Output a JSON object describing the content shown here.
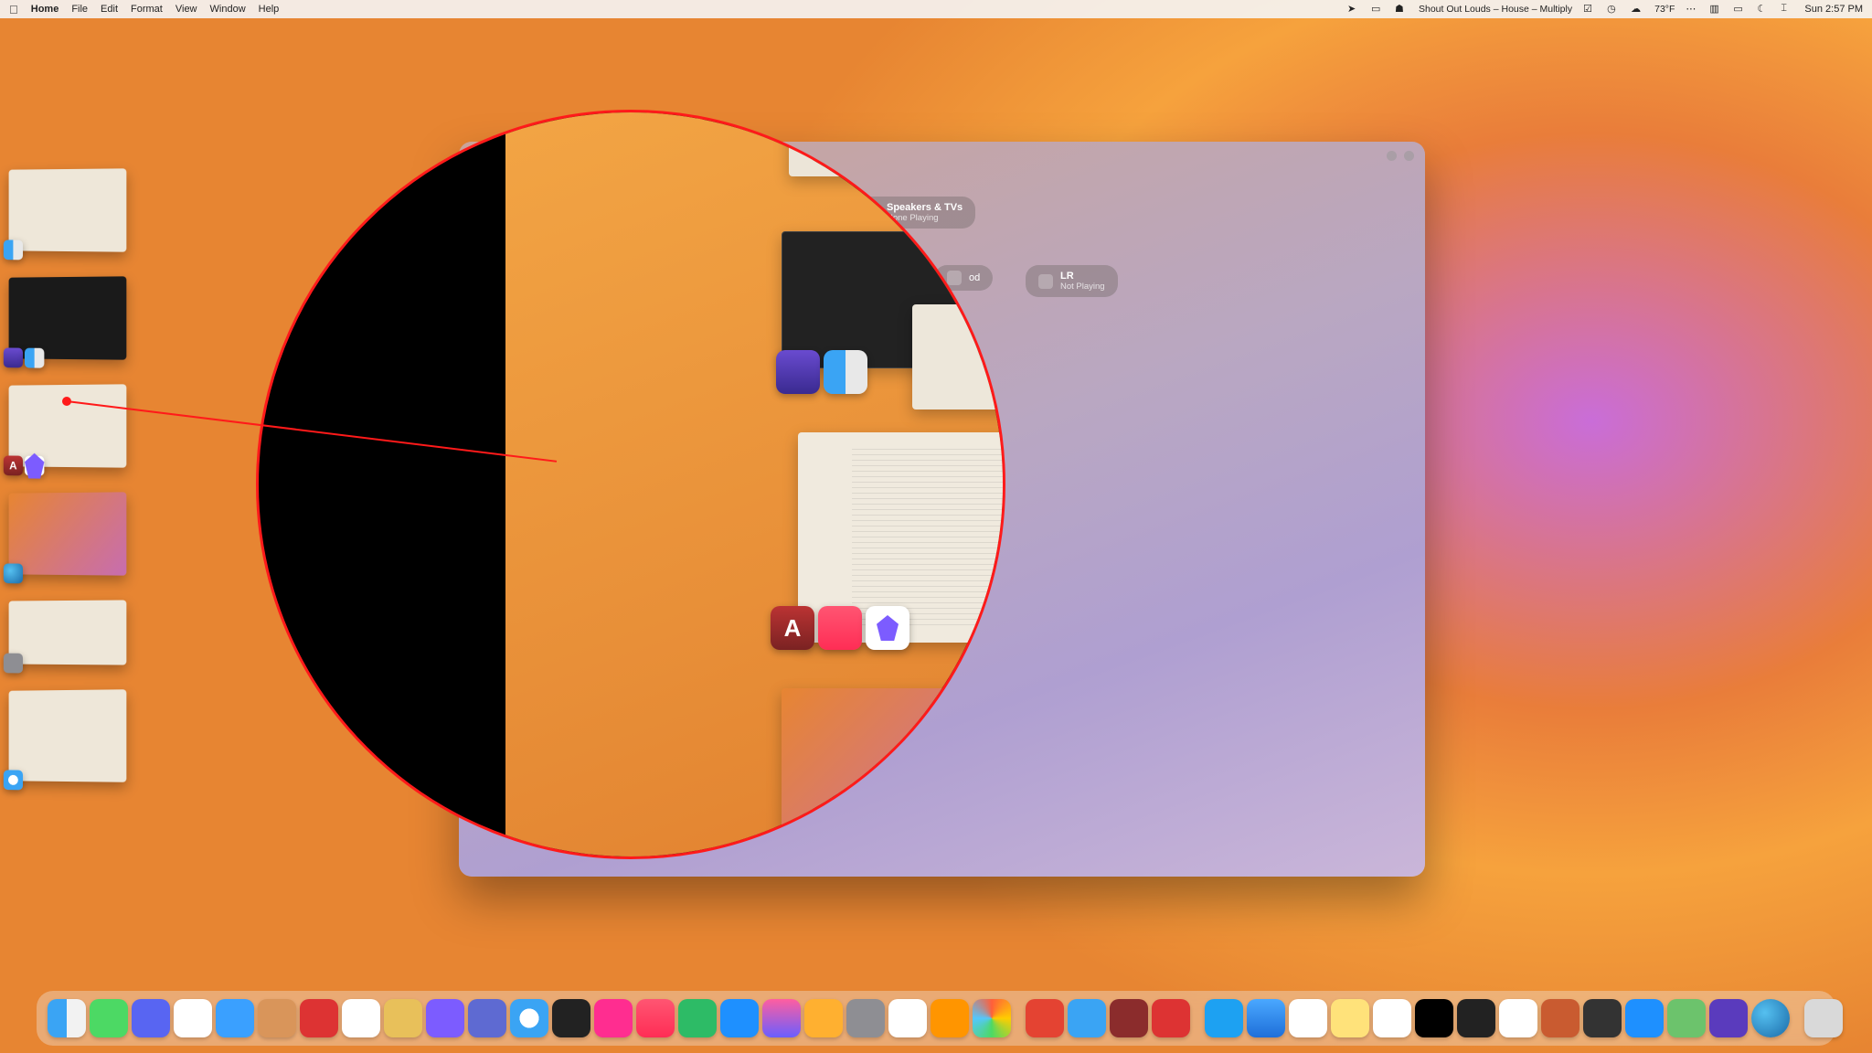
{
  "menubar": {
    "app": "Home",
    "items": [
      "File",
      "Edit",
      "Format",
      "View",
      "Window",
      "Help"
    ],
    "now_playing": "Shout Out Louds – House – Multiply",
    "temp": "73°F",
    "clock": "Sun 2:57 PM"
  },
  "home": {
    "group_title": "Speakers & TVs",
    "group_sub": "None Playing",
    "tile2_title": "od",
    "tile3_title": "LR",
    "tile3_sub": "Not Playing"
  },
  "magnifier": {
    "dict_letter": "A"
  },
  "thumbs": {
    "t1": "finder-window",
    "t2": "imovie-finder",
    "t3": "dictionary-obsidian",
    "t4": "quicktime-desktop",
    "t5": "settings",
    "t6": "safari"
  },
  "dock": {
    "labels": [
      "Finder",
      "Messages",
      "Discord",
      "Slack",
      "Apollo",
      "Package",
      "1Password",
      "Calendar",
      "GIMP",
      "Obsidian",
      "Linear",
      "Safari",
      "Figma",
      "iTunes",
      "Music",
      "Numbers",
      "App Store",
      "Shortcuts",
      "Home",
      "System Settings",
      "Freeform",
      "Pages",
      "Photos",
      "Todoist",
      "Mail",
      "Dictionary",
      "PDF Expert",
      "Twitter",
      "Weather",
      "Reminders",
      "Notes",
      "Things",
      "Clock",
      "Screens",
      "ScanSnap",
      "Drafts",
      "Calculator",
      "Keynote",
      "Maps",
      "iMovie",
      "QuickLook",
      "Trash"
    ]
  }
}
